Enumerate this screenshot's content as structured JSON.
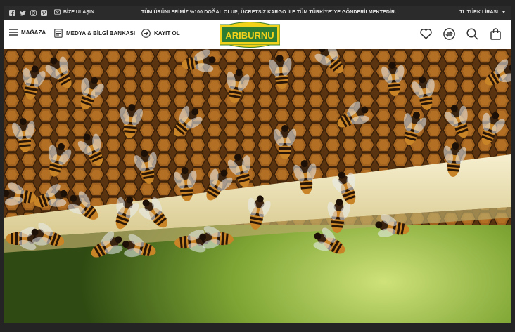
{
  "topbar": {
    "social_icons": [
      "facebook-icon",
      "twitter-icon",
      "instagram-icon",
      "pinterest-icon"
    ],
    "contact_label": "BİZE ULAŞIN",
    "announcement": "TÜM ÜRÜNLERİMİZ %100 DOĞAL OLUP; ÜCRETSİZ KARGO İLE TÜM TÜRKİYE' YE GÖNDERİLMEKTEDİR.",
    "currency_label": "TL TÜRK LİRASI"
  },
  "header": {
    "store_label": "MAĞAZA",
    "media_label": "MEDYA & BİLGİ BANKASI",
    "register_label": "KAYIT OL",
    "logo_text": "ARIBURNU",
    "icons": [
      "heart-icon",
      "compare-icon",
      "search-icon",
      "bag-icon"
    ]
  },
  "hero": {
    "image": "honeybees-on-honeycomb"
  },
  "colors": {
    "topbar_bg": "#2b2b2b",
    "header_bg": "#ffffff",
    "logo_yellow": "#f2d21b",
    "logo_green": "#2e7d32"
  }
}
